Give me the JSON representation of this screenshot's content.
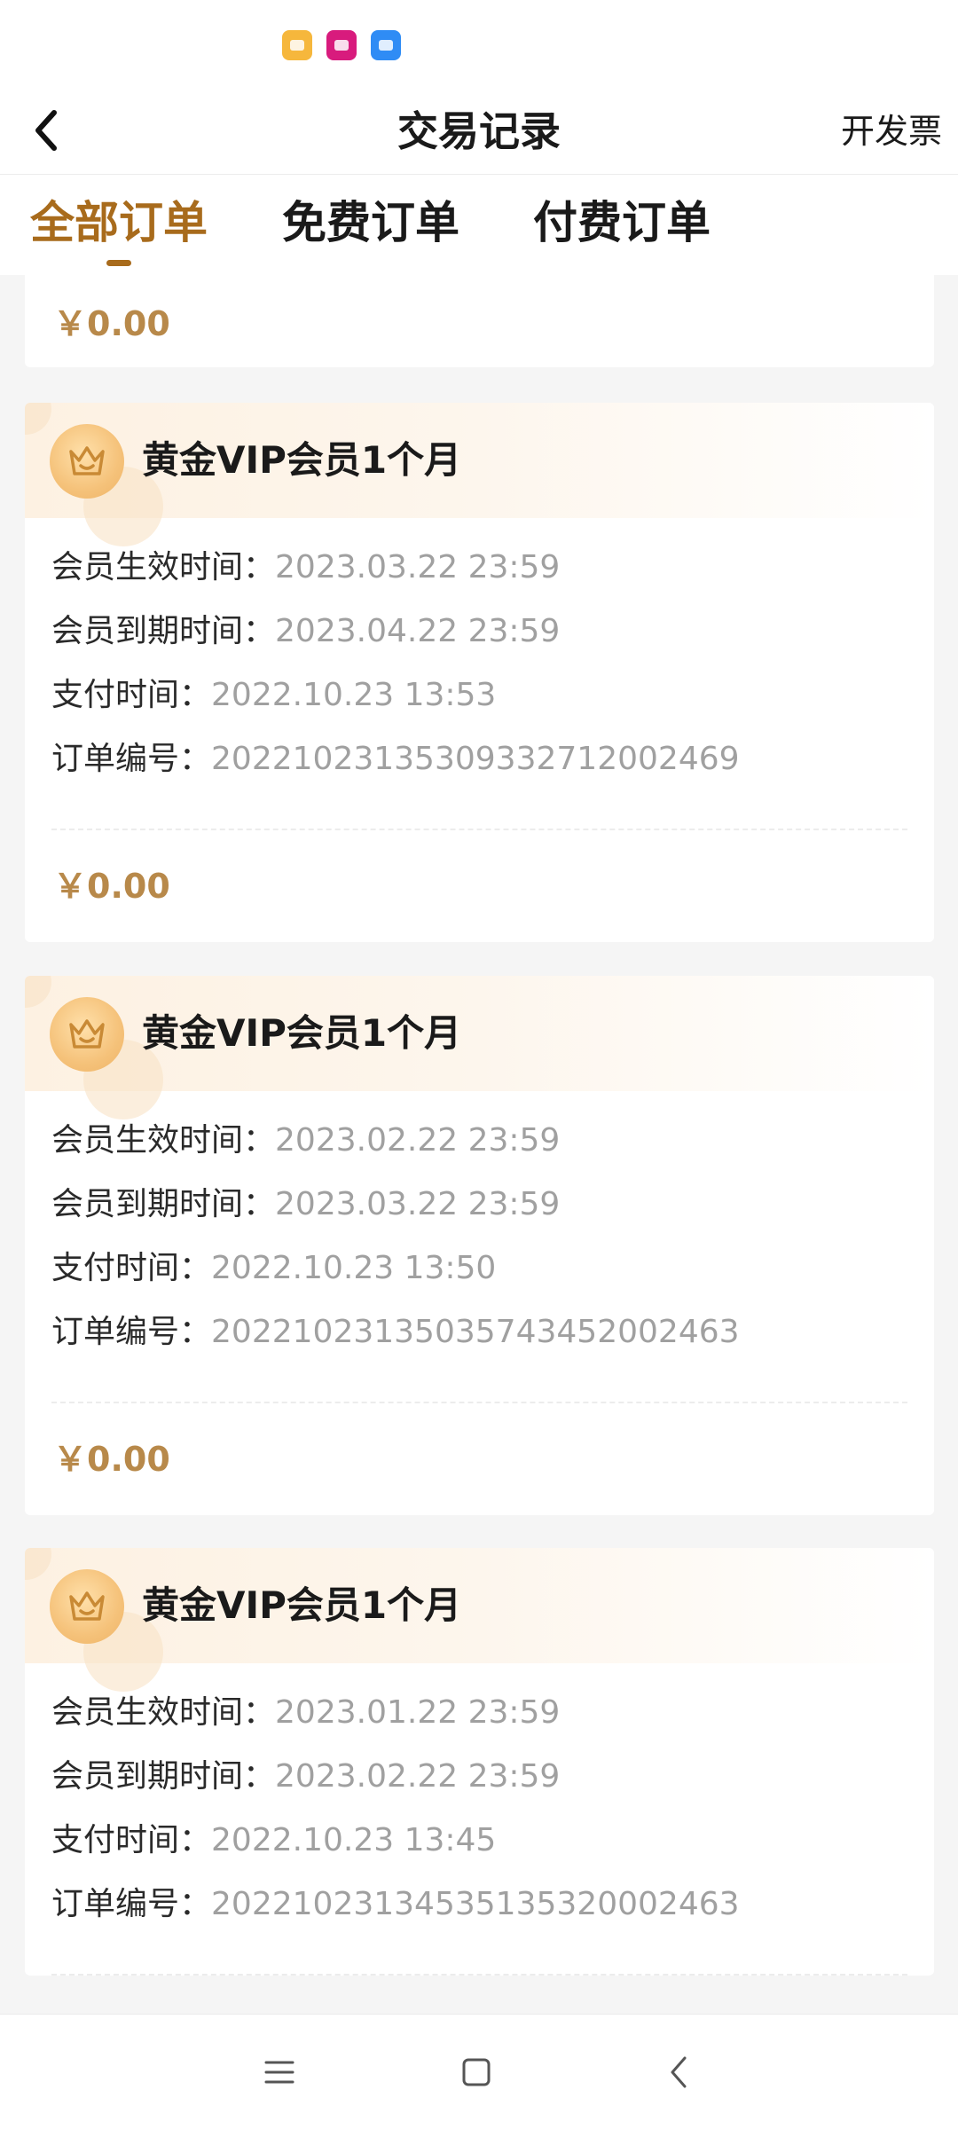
{
  "header": {
    "title": "交易记录",
    "invoice_label": "开发票"
  },
  "tabs": [
    {
      "label": "全部订单",
      "active": true
    },
    {
      "label": "免费订单",
      "active": false
    },
    {
      "label": "付费订单",
      "active": false
    }
  ],
  "icons": {
    "status_apps": [
      "notes-app-icon",
      "shopping-app-icon",
      "translate-app-icon"
    ],
    "crown": "crown-icon",
    "back": "chevron-left-icon",
    "nav": [
      "menu-icon",
      "home-icon",
      "back-icon"
    ]
  },
  "colors": {
    "accent": "#a86b1c",
    "price": "#b8894a",
    "value_gray": "#a0a0a0"
  },
  "first_card_price": "￥0.00",
  "orders": [
    {
      "title": "黄金VIP会员1个月",
      "effective_label": "会员生效时间：",
      "effective_value": "2023.03.22 23:59",
      "expire_label": "会员到期时间：",
      "expire_value": "2023.04.22 23:59",
      "pay_label": "支付时间：",
      "pay_value": "2022.10.23 13:53",
      "order_label": "订单编号：",
      "order_value": "20221023135309332712002469",
      "price": "￥0.00"
    },
    {
      "title": "黄金VIP会员1个月",
      "effective_label": "会员生效时间：",
      "effective_value": "2023.02.22 23:59",
      "expire_label": "会员到期时间：",
      "expire_value": "2023.03.22 23:59",
      "pay_label": "支付时间：",
      "pay_value": "2022.10.23 13:50",
      "order_label": "订单编号：",
      "order_value": "20221023135035743452002463",
      "price": "￥0.00"
    },
    {
      "title": "黄金VIP会员1个月",
      "effective_label": "会员生效时间：",
      "effective_value": "2023.01.22 23:59",
      "expire_label": "会员到期时间：",
      "expire_value": "2023.02.22 23:59",
      "pay_label": "支付时间：",
      "pay_value": "2022.10.23 13:45",
      "order_label": "订单编号：",
      "order_value": "20221023134535135320002463",
      "price": ""
    }
  ]
}
